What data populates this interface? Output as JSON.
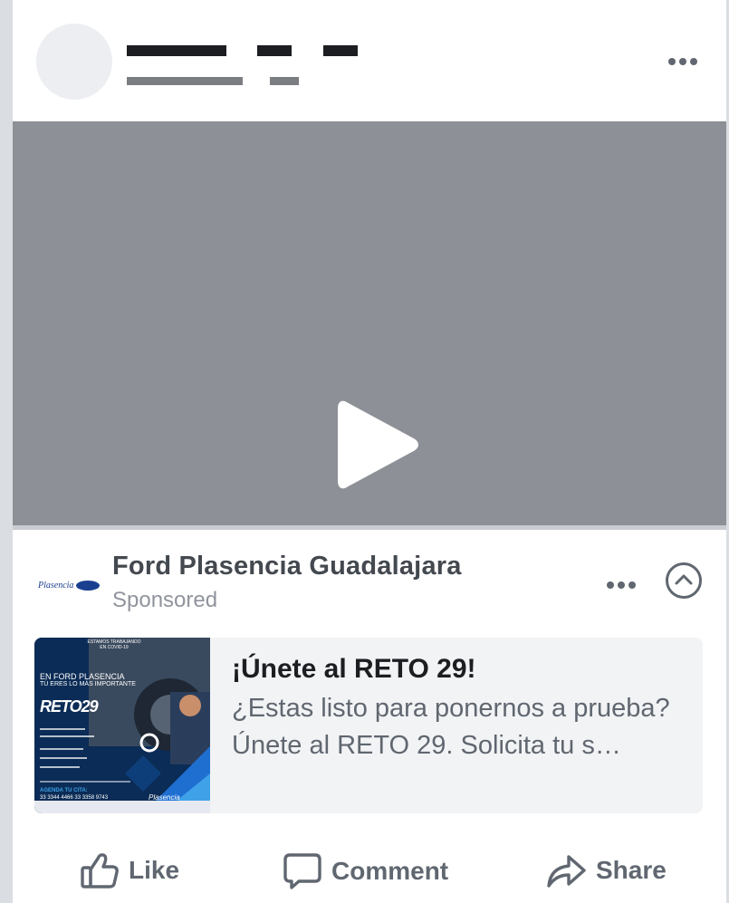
{
  "post": {
    "header": {
      "menu_icon": "more-dots-icon"
    },
    "video": {
      "play_icon": "play-icon"
    }
  },
  "ad": {
    "page_name": "Ford Plasencia Guadalajara",
    "sponsored_label": "Sponsored",
    "logo": {
      "brand": "Plasencia",
      "icon": "ford-oval-logo"
    },
    "menu_icon": "more-dots-icon",
    "collapse_icon": "chevron-up-circle-icon",
    "link": {
      "title": "¡Únete al RETO 29!",
      "description": "¿Estas listo para ponernos a prueba? Únete al RETO 29. Solicita tu s…",
      "thumbnail": {
        "top_badge": "ESTAMOS TRABAJANDO EN COVID-19",
        "headline_1": "EN FORD PLASENCIA",
        "headline_2": "TÚ ERES LO MÁS IMPORTANTE",
        "promo_name": "RETO29",
        "cta": "AGENDA TU CITA:",
        "phones": "33 3344 4466  33 3358 9743",
        "brand": "Plasencia"
      }
    }
  },
  "actions": {
    "like_label": "Like",
    "comment_label": "Comment",
    "share_label": "Share",
    "like_icon": "thumbs-up-icon",
    "comment_icon": "speech-bubble-icon",
    "share_icon": "share-arrow-icon"
  },
  "colors": {
    "text_primary": "#1c1e21",
    "text_secondary": "#606770",
    "video_placeholder": "#8d9096",
    "ford_blue": "#1b3f8f"
  }
}
